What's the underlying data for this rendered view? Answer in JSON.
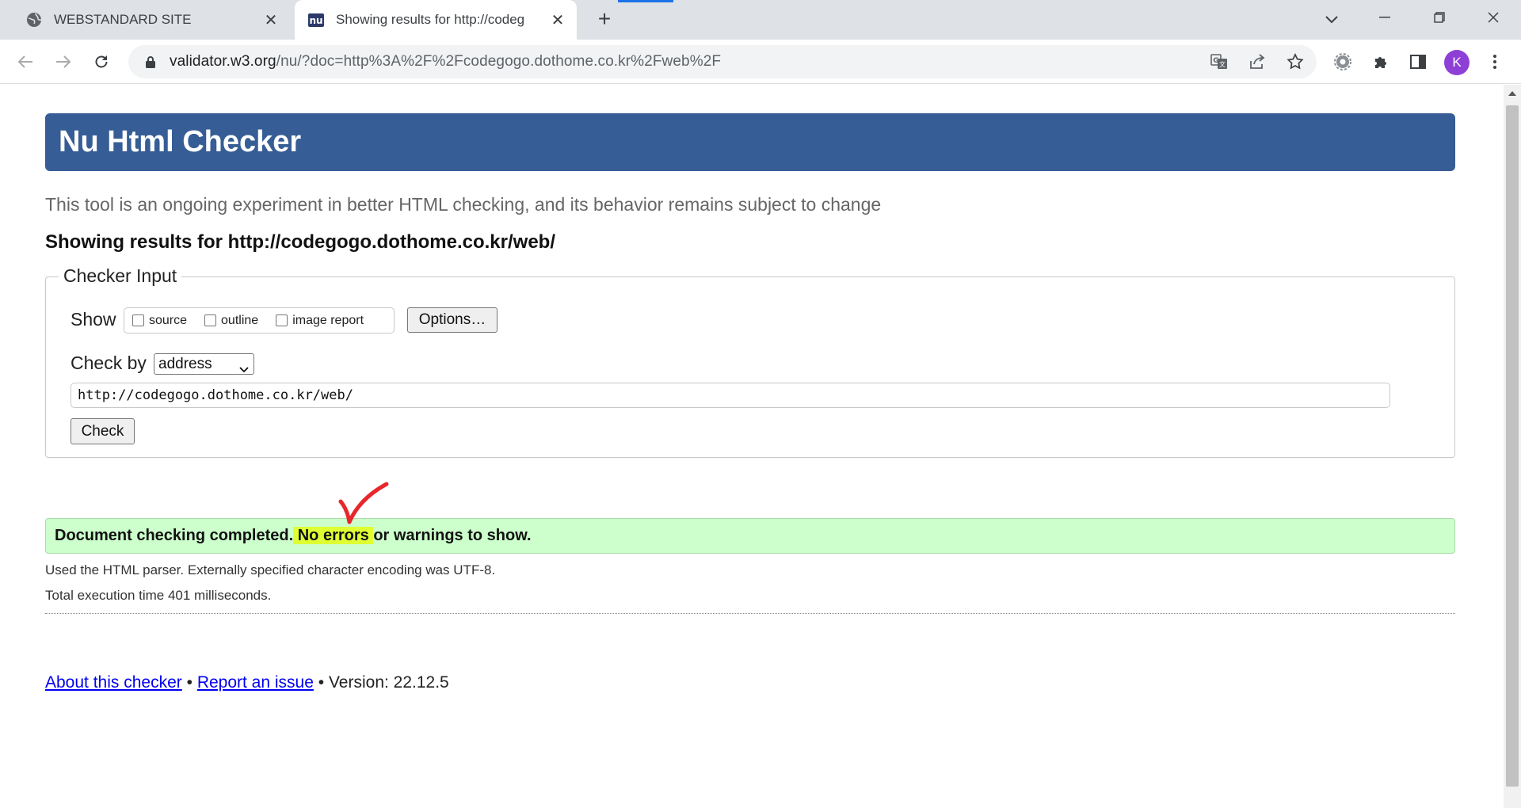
{
  "browser": {
    "tabs": [
      {
        "title": "WEBSTANDARD SITE",
        "icon": "globe-icon",
        "active": false
      },
      {
        "title": "Showing results for http://codeg",
        "icon": "nu-favicon-icon",
        "active": true
      }
    ],
    "address_bar": {
      "host": "validator.w3.org",
      "path": "/nu/?doc=http%3A%2F%2Fcodegogo.dothome.co.kr%2Fweb%2F"
    },
    "profile_initial": "K",
    "accent_color": "#1a73e8"
  },
  "page": {
    "header_title": "Nu Html Checker",
    "intro": "This tool is an ongoing experiment in better HTML checking, and its behavior remains subject to change",
    "showing_results": "Showing results for http://codegogo.dothome.co.kr/web/",
    "checker_input": {
      "legend": "Checker Input",
      "show_label": "Show",
      "checkboxes": [
        {
          "label": "source",
          "checked": false
        },
        {
          "label": "outline",
          "checked": false
        },
        {
          "label": "image report",
          "checked": false
        }
      ],
      "options_button": "Options…",
      "check_by_label": "Check by",
      "check_by_value": "address",
      "url_value": "http://codegogo.dothome.co.kr/web/",
      "check_button": "Check"
    },
    "result": {
      "prefix": "Document checking completed.",
      "highlight": " No errors ",
      "suffix": "or warnings to show.",
      "color": "#ccffcc",
      "highlight_color": "#dfff33"
    },
    "details": [
      "Used the HTML parser. Externally specified character encoding was UTF-8.",
      "Total execution time 401 milliseconds."
    ],
    "footer": {
      "about_link": "About this checker",
      "separator": "•",
      "report_link": "Report an issue",
      "version": "Version: 22.12.5"
    },
    "header_color": "#365d95"
  }
}
